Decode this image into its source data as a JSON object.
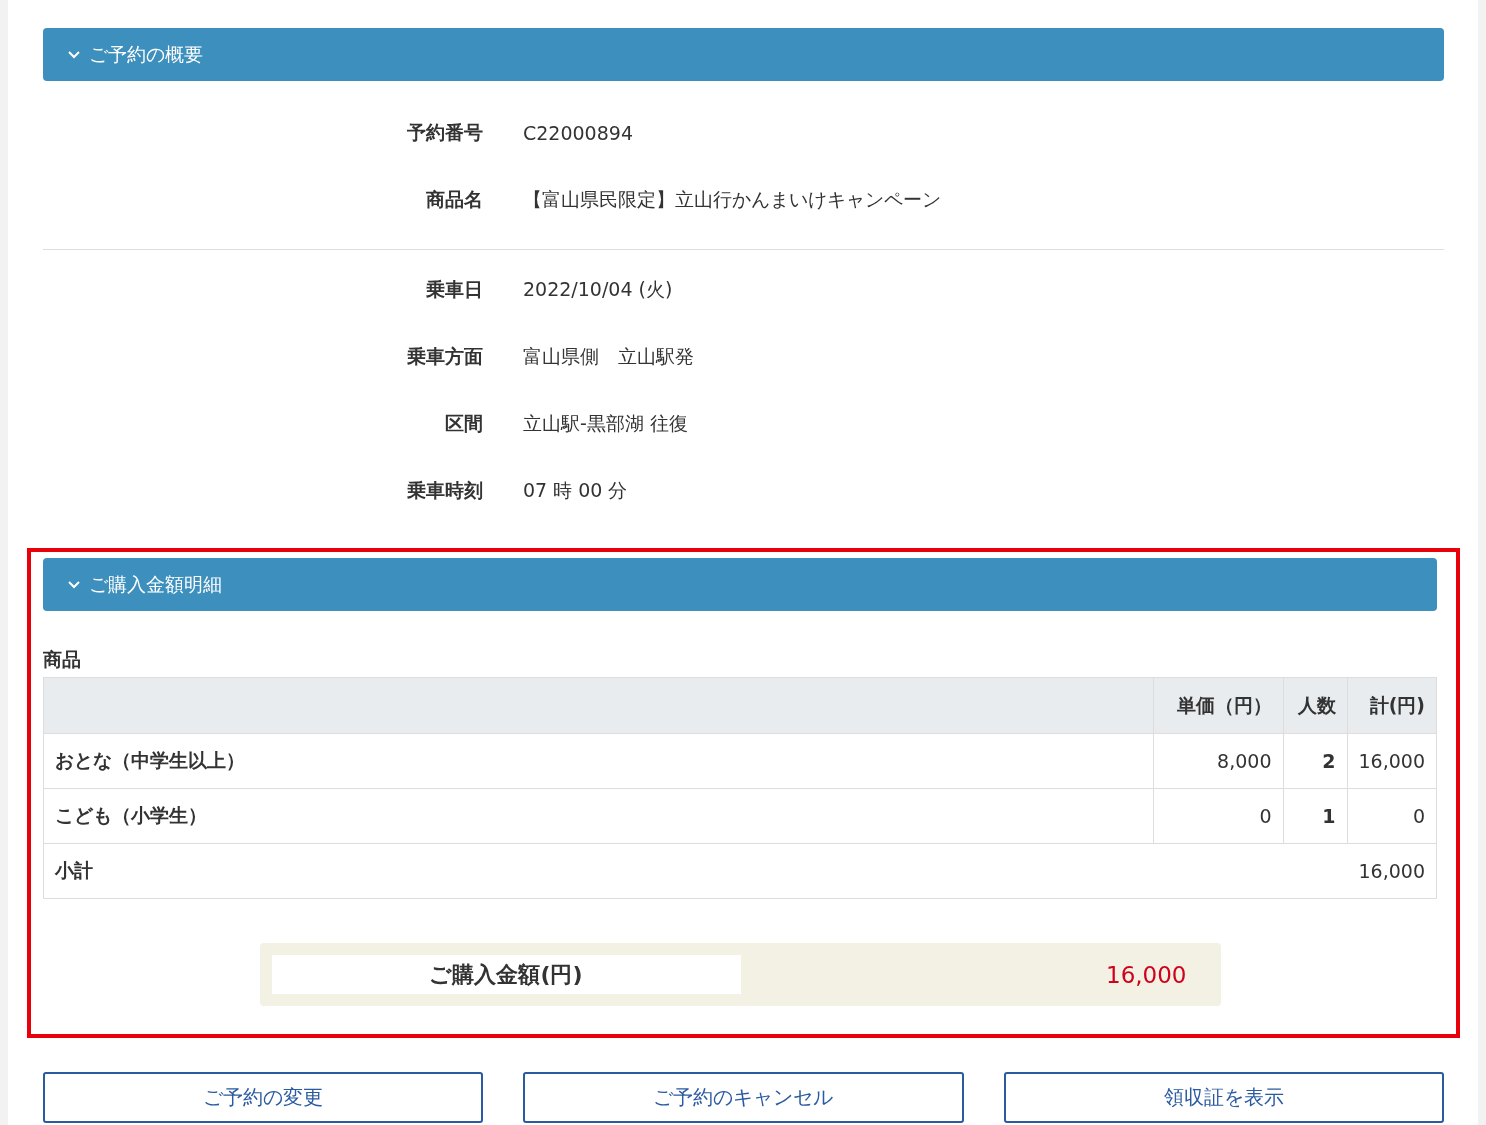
{
  "summary": {
    "title": "ご予約の概要",
    "expanded": true,
    "groups": [
      [
        {
          "label": "予約番号",
          "value": "C22000894"
        },
        {
          "label": "商品名",
          "value": "【富山県民限定】立山行かんまいけキャンペーン"
        }
      ],
      [
        {
          "label": "乗車日",
          "value": "2022/10/04 (火)"
        },
        {
          "label": "乗車方面",
          "value": "富山県側　立山駅発"
        },
        {
          "label": "区間",
          "value": "立山駅-黒部湖 往復"
        },
        {
          "label": "乗車時刻",
          "value": "07 時 00 分"
        }
      ]
    ]
  },
  "purchase": {
    "title": "ご購入金額明細",
    "expanded": true,
    "highlighted": true,
    "caption": "商品",
    "columns": [
      "単価（円）",
      "人数",
      "計(円)"
    ],
    "rows": [
      {
        "name": "おとな（中学生以上）",
        "unit_price": "8,000",
        "count": "2",
        "total": "16,000"
      },
      {
        "name": "こども（小学生）",
        "unit_price": "0",
        "count": "1",
        "total": "0"
      }
    ],
    "subtotal": {
      "label": "小計",
      "value": "16,000"
    },
    "total": {
      "label": "ご購入金額(円)",
      "value": "16,000"
    }
  },
  "buttons": [
    "ご予約の変更",
    "ご予約のキャンセル",
    "領収証を表示"
  ]
}
